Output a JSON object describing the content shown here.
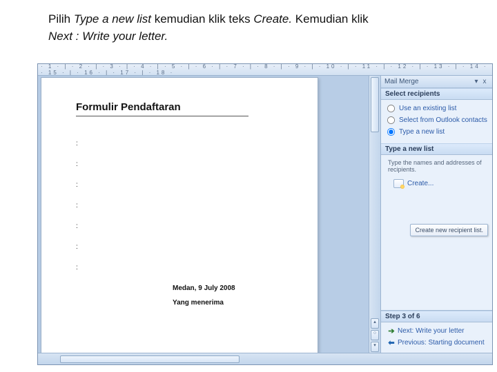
{
  "instruction": {
    "p1": "Pilih ",
    "i1": "Type a new list ",
    "p2": "kemudian klik teks ",
    "i2": "Create.",
    "p3": " Kemudian klik ",
    "i3": "Next : Write your letter."
  },
  "ruler": "· 1 · | · 2 · | · 3 · | · 4 · | · 5 · | · 6 · | · 7 · | · 8 · | · 9 · | · 10 · | · 11 · | · 12 · | · 13 · | · 14 ·  · 15 · | · 16 · | · 17 · | · 18 ·",
  "document": {
    "title": "Formulir Pendaftaran",
    "fields": [
      ":",
      ":",
      ":",
      ":",
      ":",
      ":",
      ":"
    ],
    "datecity": "Medan, 9 July 2008",
    "receiver": "Yang menerima"
  },
  "pane": {
    "title": "Mail Merge",
    "close": "x",
    "dropdown": "▾",
    "sections": {
      "select": {
        "head": "Select recipients",
        "opts": [
          {
            "label": "Use an existing list",
            "checked": false
          },
          {
            "label": "Select from Outlook contacts",
            "checked": false
          },
          {
            "label": "Type a new list",
            "checked": true
          }
        ]
      },
      "newlist": {
        "head": "Type a new list",
        "hint": "Type the names and addresses of recipients.",
        "create": "Create...",
        "tooltip": "Create new recipient list."
      },
      "step": {
        "head": "Step 3 of 6",
        "next": "Next: Write your letter",
        "prev": "Previous: Starting document"
      }
    }
  }
}
